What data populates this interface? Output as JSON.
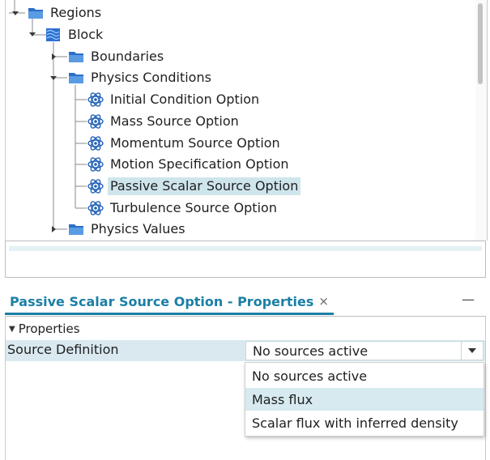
{
  "tree": {
    "nodes": [
      {
        "label": "Regions",
        "icon": "folder-icon",
        "expanded": true
      },
      {
        "label": "Block",
        "icon": "block-icon",
        "expanded": true
      },
      {
        "label": "Boundaries",
        "icon": "folder-icon",
        "expanded": false
      },
      {
        "label": "Physics Conditions",
        "icon": "folder-icon",
        "expanded": true
      },
      {
        "label": "Initial Condition Option",
        "icon": "atom-icon"
      },
      {
        "label": "Mass Source Option",
        "icon": "atom-icon"
      },
      {
        "label": "Momentum Source Option",
        "icon": "atom-icon"
      },
      {
        "label": "Motion Specification Option",
        "icon": "atom-icon"
      },
      {
        "label": "Passive Scalar Source Option",
        "icon": "atom-icon",
        "selected": true
      },
      {
        "label": "Turbulence Source Option",
        "icon": "atom-icon"
      },
      {
        "label": "Physics Values",
        "icon": "folder-icon",
        "expanded": false
      }
    ]
  },
  "properties_panel": {
    "title": "Passive Scalar Source Option - Properties",
    "close_glyph": "×",
    "minimize_glyph": "—",
    "group_label": "Properties",
    "row": {
      "label": "Source Definition",
      "value": "No sources active"
    },
    "dropdown_options": [
      "No sources active",
      "Mass flux",
      "Scalar flux with inferred density"
    ],
    "hovered_option": "Mass flux"
  },
  "colors": {
    "accent": "#1b7fa5",
    "selection": "#cfe5ec",
    "folder": "#2b6fc9",
    "atom": "#2160b8"
  }
}
